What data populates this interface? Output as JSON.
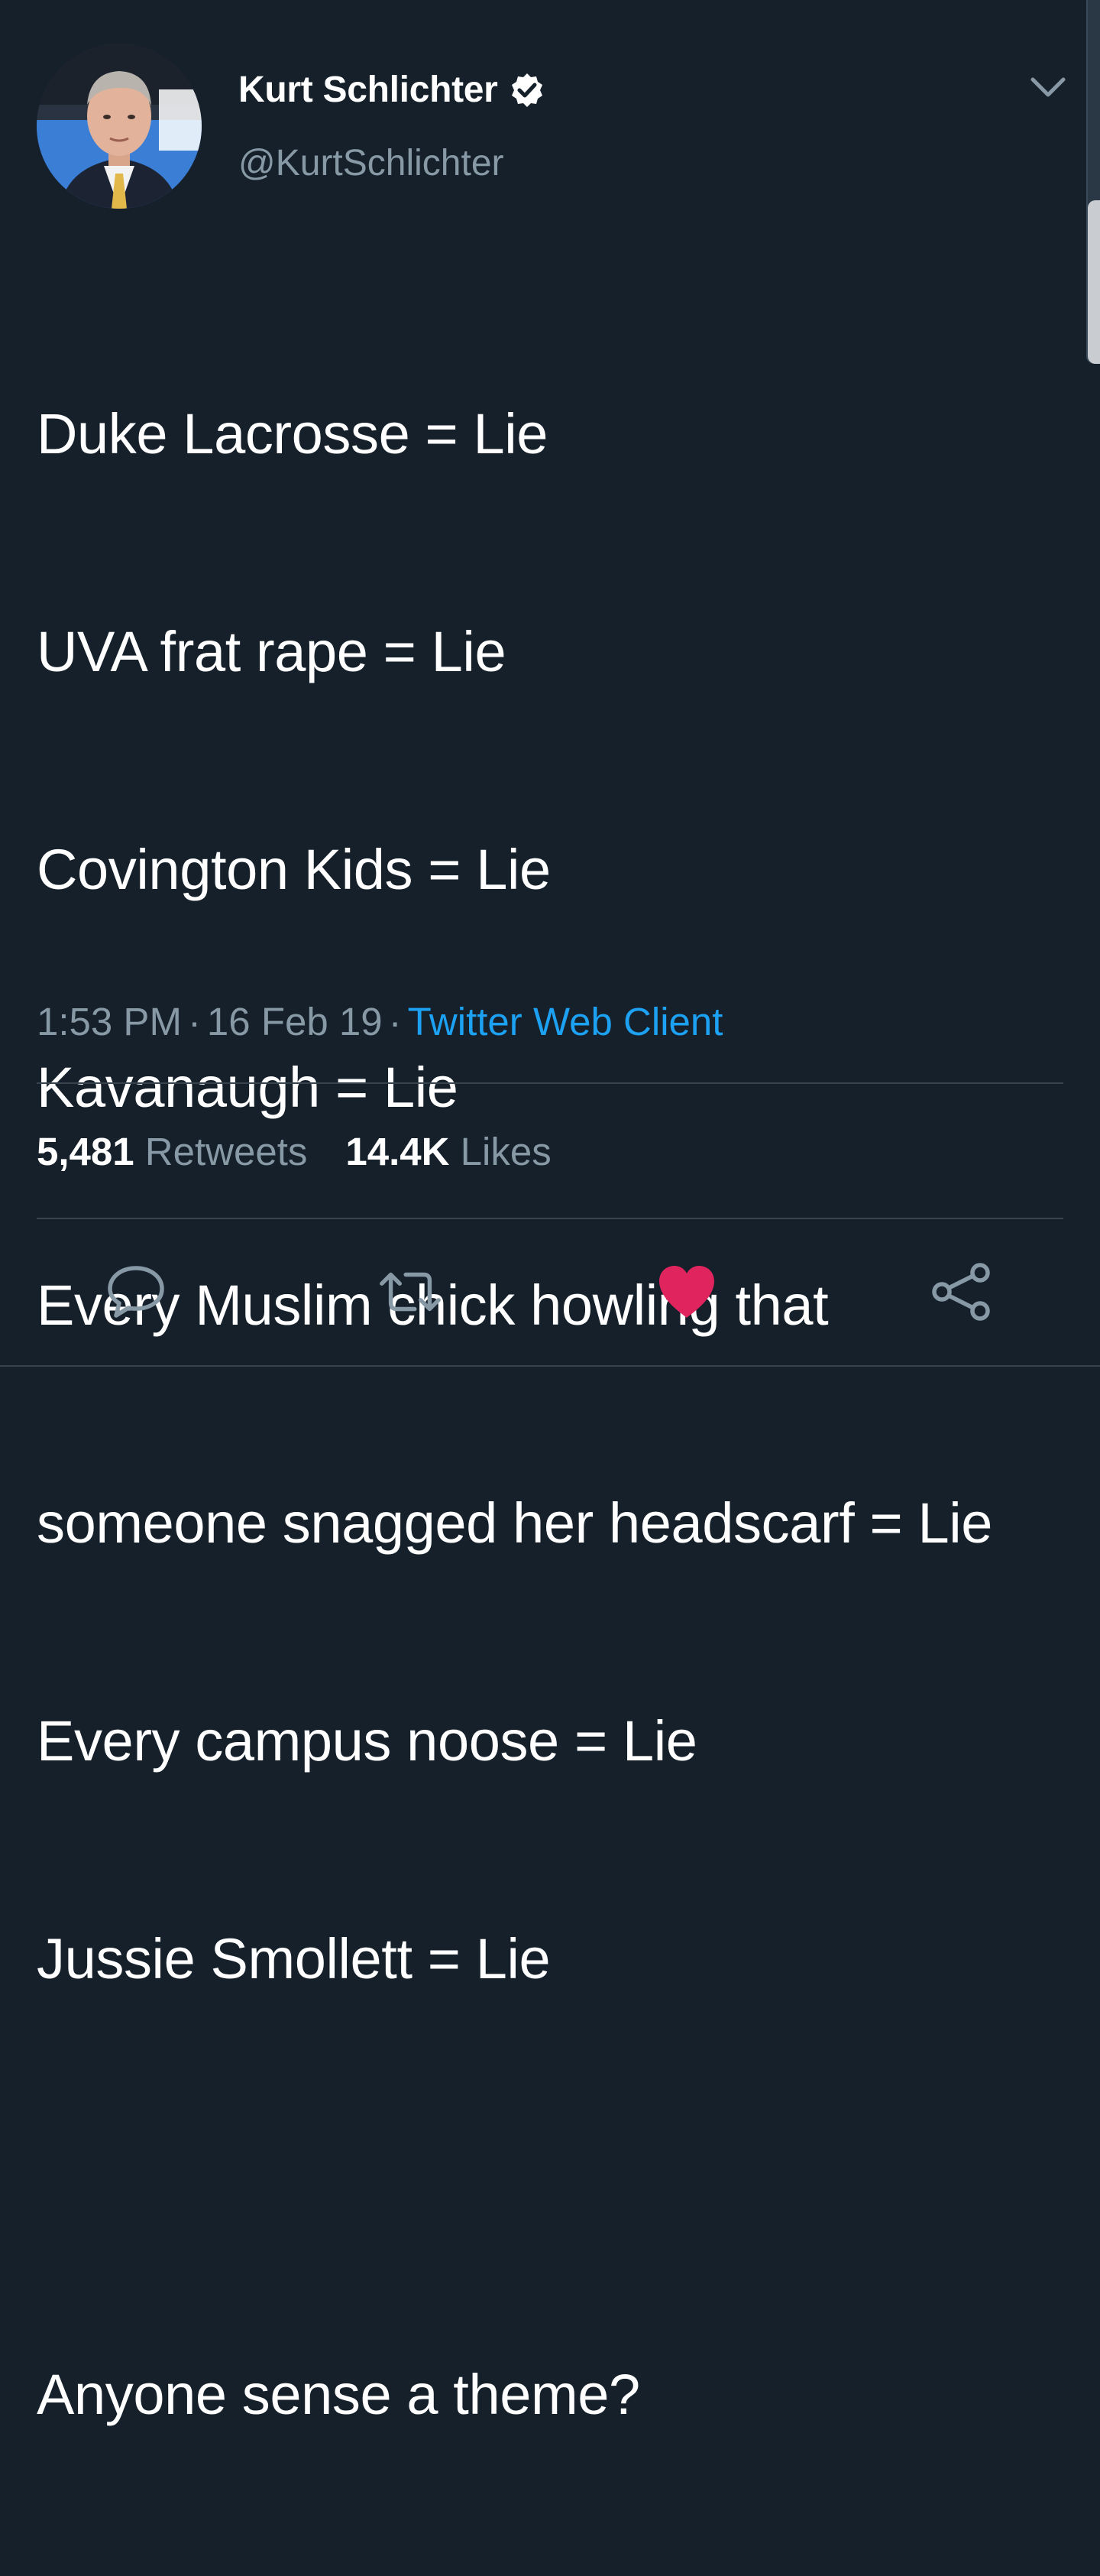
{
  "author": {
    "display_name": "Kurt Schlichter",
    "handle": "@KurtSchlichter",
    "verified": true
  },
  "tweet": {
    "lines": [
      "Duke Lacrosse = Lie",
      "UVA frat rape = Lie",
      "Covington Kids = Lie",
      "Kavanaugh = Lie",
      "Every Muslim chick howling that",
      "someone snagged her headscarf = Lie",
      "Every campus noose = Lie",
      "Jussie Smollett = Lie"
    ],
    "closing": "Anyone sense a theme?"
  },
  "meta": {
    "time": "1:53 PM",
    "separator": "·",
    "date": "16 Feb 19",
    "source": "Twitter Web Client"
  },
  "stats": {
    "retweets_count": "5,481",
    "retweets_label": "Retweets",
    "likes_count": "14.4K",
    "likes_label": "Likes"
  },
  "colors": {
    "background": "#15202b",
    "secondary_text": "#8899a6",
    "link": "#1da1f2",
    "like_active": "#e0245e",
    "divider": "#38444d"
  },
  "icons": {
    "verified": "verified-badge-icon",
    "more": "chevron-down-icon",
    "reply": "reply-icon",
    "retweet": "retweet-icon",
    "like": "heart-icon",
    "share": "share-icon"
  },
  "liked": true
}
